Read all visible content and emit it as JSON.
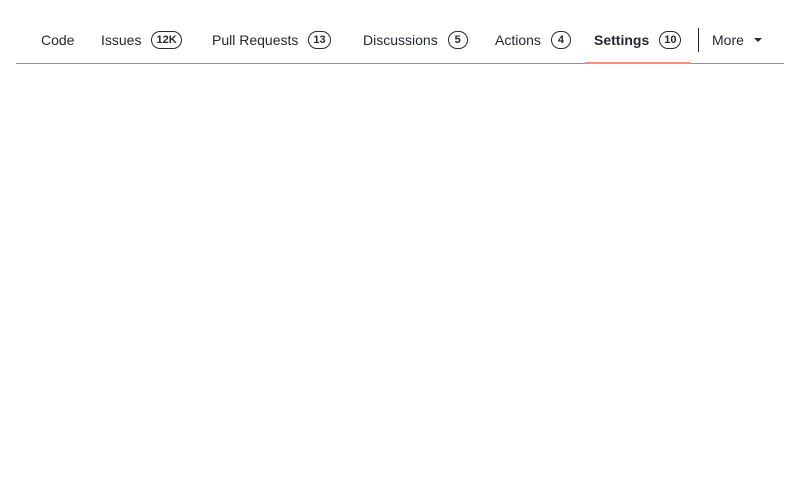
{
  "tabs": [
    {
      "label": "Code",
      "counter": null,
      "selected": false
    },
    {
      "label": "Issues",
      "counter": "12K",
      "selected": false
    },
    {
      "label": "Pull Requests",
      "counter": "13",
      "selected": false
    },
    {
      "label": "Discussions",
      "counter": "5",
      "selected": false
    },
    {
      "label": "Actions",
      "counter": "4",
      "selected": false
    },
    {
      "label": "Settings",
      "counter": "10",
      "selected": true
    }
  ],
  "more": {
    "label": "More",
    "icon": "caret-down-icon"
  },
  "colors": {
    "selected_underline": "#fd8c73",
    "border": "#8c959f",
    "text": "#24292f"
  }
}
